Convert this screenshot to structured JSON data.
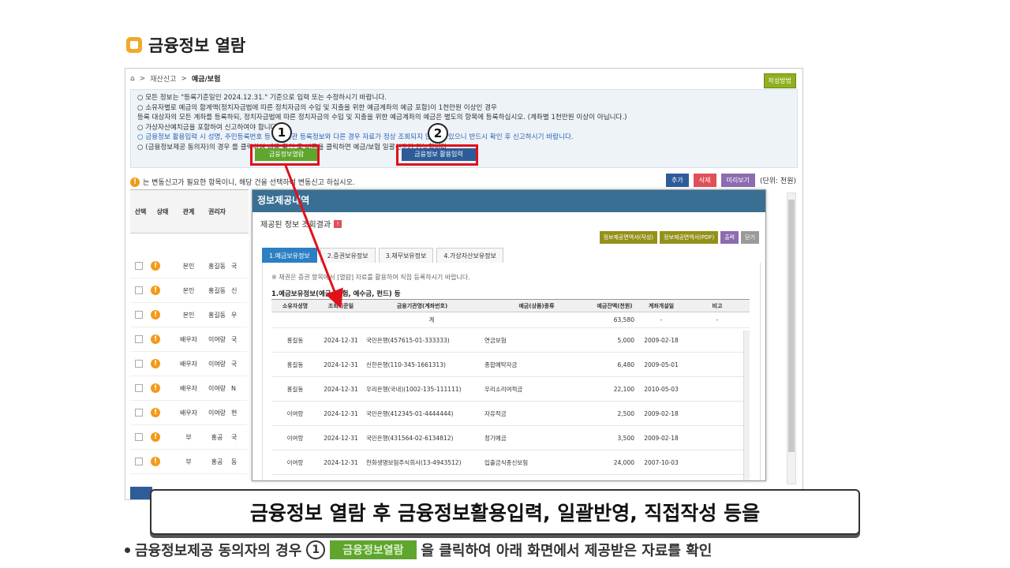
{
  "heading": "금융정보 열람",
  "breadcrumb": {
    "home_icon": "home-icon",
    "sep": ">",
    "parent": "재산신고",
    "current": "예금/보험"
  },
  "help_button": "작성방법",
  "notice": [
    "○ 모든 정보는 \"등록기준일인 2024.12.31.\" 기준으로 입력 또는 수정하시기 바랍니다.",
    "○ 소유자별로 예금의 합계액(정치자금법에 따른 정치자금의 수입 및 지출을 위한 예금계좌의 예금 포함)이 1천만원 이상인 경우",
    "   등록 대상자의 모든 계좌를 등록하되, 정치자금법에 따른 정치자금의 수입 및 지출을 위한 예금계좌의 예금은 별도의 항목에 등록하십시오. (계좌별 1천만원 이상이 아닙니다.)",
    "○ 가상자산예치금을 포함하여 신고하여야 합니다.",
    "○ 금융정보 활용입력 시 성명, 주민등록번호 등 금융기관 등록정보와 다른 경우 자료가 정상 조회되지 않을 수 있으니 반드시 확인 후 신고하시기 바랍니다.",
    "○ (금융정보제공 동의자)의 경우              를 클릭하여 내용 확인 후                    버튼을 클릭하면 예금/보험 일괄신고가 가능합니다."
  ],
  "buttons": {
    "view_finance": "금융정보열람",
    "finance_input": "금융정보 활용입력"
  },
  "markers": [
    "1",
    "2"
  ],
  "warn_text": "는 변동신고가 필요한 항목이니, 해당 건을 선택하여 변동신고 하십시오.",
  "actions": {
    "add": "추가",
    "delete": "삭제",
    "preview": "미리보기",
    "unit": "(단위: 천원)"
  },
  "bg_table": {
    "headers": [
      "선택",
      "상태",
      "관계",
      "권리자"
    ],
    "rows": [
      {
        "rel": "본인",
        "owner": "홍길동",
        "x": "국"
      },
      {
        "rel": "본인",
        "owner": "홍길동",
        "x": "신"
      },
      {
        "rel": "본인",
        "owner": "홍길동",
        "x": "우"
      },
      {
        "rel": "배우자",
        "owner": "이여랑",
        "x": "국"
      },
      {
        "rel": "배우자",
        "owner": "이여랑",
        "x": "국"
      },
      {
        "rel": "배우자",
        "owner": "이여랑",
        "x": "N"
      },
      {
        "rel": "배우자",
        "owner": "이여랑",
        "x": "현"
      },
      {
        "rel": "부",
        "owner": "홍공",
        "x": "국"
      },
      {
        "rel": "부",
        "owner": "홍공",
        "x": "동"
      }
    ]
  },
  "popup": {
    "title": "정보제공내역",
    "subtitle": "제공된 정보 조회결과",
    "buttons": [
      "정보제공면역서(작성)",
      "정보제공면역서(PDF)",
      "출력",
      "닫기"
    ],
    "tabs": [
      "1.예금보유정보",
      "2.증권보유정보",
      "3.채무보유정보",
      "4.가상자산보유정보"
    ],
    "note": "※ 채권은 증권 항목에서 [열람] 자료를 활용하여 직접 등록하시기 바랍니다.",
    "section_title": "1.예금보유정보(예금, 보험, 예수금, 펀드) 등",
    "columns": [
      "소유자성명",
      "조회기준일",
      "금융기관명(계좌번호)",
      "예금(상품)종류",
      "예금잔액(천원)",
      "계좌개설일",
      "비고"
    ],
    "sum_row": {
      "label": "계",
      "amount": "63,580",
      "date": "-",
      "note": "-"
    },
    "rows": [
      {
        "name": "홍길동",
        "date": "2024-12-31",
        "bank": "국민은행(457615-01-333333)",
        "kind": "연금보험",
        "amount": "5,000",
        "opened": "2009-02-18"
      },
      {
        "name": "홍길동",
        "date": "2024-12-31",
        "bank": "신한은행(110-345-1661313)",
        "kind": "종합예탁자금",
        "amount": "6,480",
        "opened": "2009-05-01"
      },
      {
        "name": "홍길동",
        "date": "2024-12-31",
        "bank": "우리은행(국내)(1002-135-111111)",
        "kind": "우리소리여적금",
        "amount": "22,100",
        "opened": "2010-05-03"
      },
      {
        "name": "이여랑",
        "date": "2024-12-31",
        "bank": "국민은행(412345-01-4444444)",
        "kind": "자유적금",
        "amount": "2,500",
        "opened": "2009-02-18"
      },
      {
        "name": "이여랑",
        "date": "2024-12-31",
        "bank": "국민은행(431564-02-6134812)",
        "kind": "정기예금",
        "amount": "3,500",
        "opened": "2009-02-18"
      },
      {
        "name": "이여랑",
        "date": "2024-12-31",
        "bank": "한화생명보험주식회사(13-4943512)",
        "kind": "입출금식종신보험",
        "amount": "24,000",
        "opened": "2007-10-03"
      }
    ]
  },
  "subtitle": "금융정보 열람 후 금융정보활용입력, 일괄반영, 직접작성 등을",
  "bottom_line": {
    "prefix": "금융정보제공 동의자의 경우",
    "marker": "1",
    "button": "금융정보열람",
    "suffix": "을 클릭하여 아래 화면에서 제공받은 자료를 확인"
  },
  "colors": {
    "accent_red": "#e0111b",
    "green_btn": "#5fa52e",
    "navy_btn": "#2d5c99",
    "popup_header": "#3a6f94",
    "heading_icon": "#f0a92a"
  }
}
